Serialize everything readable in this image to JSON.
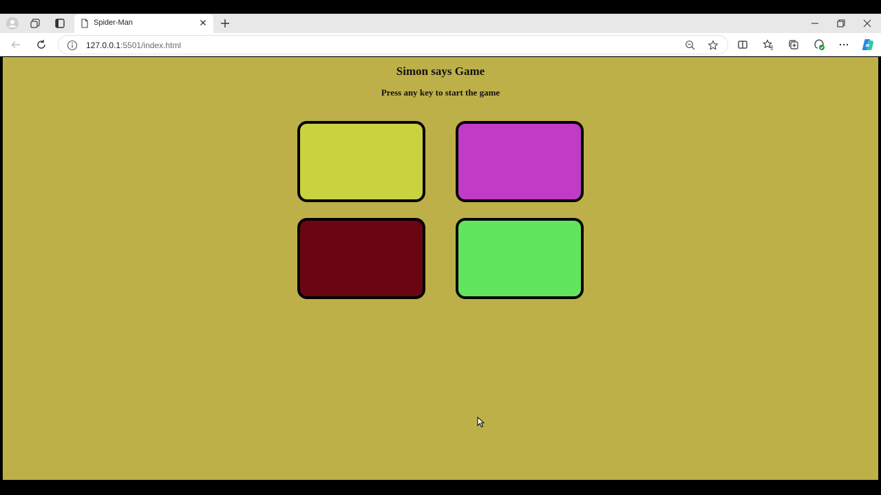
{
  "browser": {
    "tab_title": "Spider-Man",
    "url_host": "127.0.0.1",
    "url_rest": ":5501/index.html"
  },
  "icons": {
    "profile": "profile-icon",
    "workspaces": "workspaces-icon",
    "tab_actions": "tab-actions-icon",
    "page": "page-icon",
    "close": "close-icon",
    "new_tab": "plus-icon",
    "back": "back-arrow-icon",
    "refresh": "refresh-icon",
    "info": "info-icon",
    "zoom": "zoom-out-icon",
    "favorite": "star-icon",
    "split": "split-screen-icon",
    "favorites": "favorites-icon",
    "collections": "collections-icon",
    "extensions": "extensions-icon",
    "more": "more-icon",
    "copilot": "copilot-icon"
  },
  "page": {
    "title": "Simon says Game",
    "subtitle": "Press any key to start the game",
    "background": "#bdb049",
    "buttons": [
      {
        "id": "yellow",
        "color": "#cad23f"
      },
      {
        "id": "purple",
        "color": "#c03bc6"
      },
      {
        "id": "red",
        "color": "#6a0614"
      },
      {
        "id": "green",
        "color": "#62e55e"
      }
    ]
  }
}
